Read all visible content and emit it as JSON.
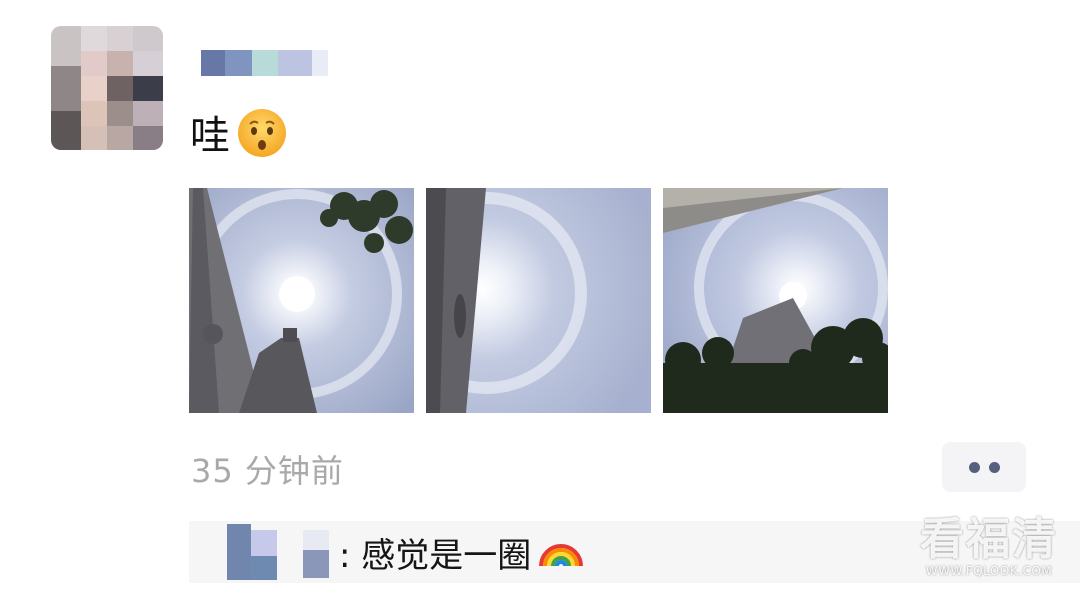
{
  "post": {
    "text": "哇",
    "emoji": "😯",
    "time": "35 分钟前"
  },
  "photos": [
    {
      "scene": "solar-halo-building-left-tree"
    },
    {
      "scene": "solar-halo-wall-left"
    },
    {
      "scene": "solar-halo-tower-trees"
    }
  ],
  "comment": {
    "text": ": 感觉是一圈",
    "emoji": "🌈"
  },
  "watermark": {
    "title": "看福清",
    "url": "WWW.FQLOOK.COM"
  },
  "colors": {
    "time": "#a9a9a9",
    "dots": "#54607d",
    "comment_bg": "#f6f6f6",
    "sky": "#b9c3dc"
  }
}
